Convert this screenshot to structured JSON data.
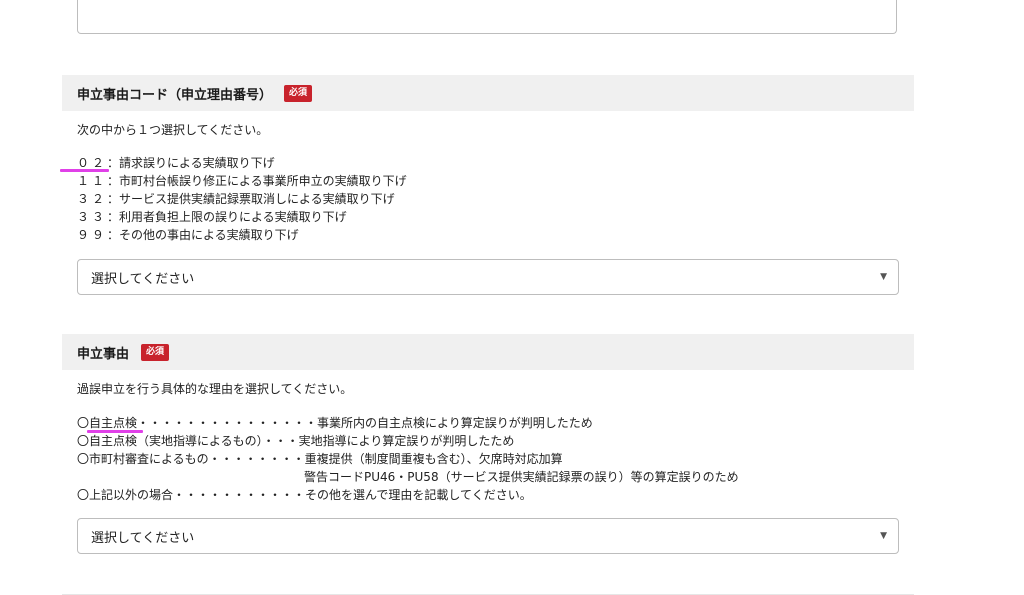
{
  "top_input": {
    "value": ""
  },
  "reason_code_section": {
    "title": "申立事由コード（申立理由番号）",
    "required_badge": "必須",
    "instruction": "次の中から１つ選択してください。",
    "options": [
      {
        "code": "０２",
        "sep": "：",
        "text": "請求誤りによる実績取り下げ"
      },
      {
        "code": "１１",
        "sep": "：",
        "text": "市町村台帳誤り修正による事業所申立の実績取り下げ"
      },
      {
        "code": "３２",
        "sep": "：",
        "text": "サービス提供実績記録票取消しによる実績取り下げ"
      },
      {
        "code": "３３",
        "sep": "：",
        "text": "利用者負担上限の誤りによる実績取り下げ"
      },
      {
        "code": "９９",
        "sep": "：",
        "text": "その他の事由による実績取り下げ"
      }
    ],
    "select": {
      "value": "選択してください"
    }
  },
  "reason_section": {
    "title": "申立事由",
    "required_badge": "必須",
    "instruction": "過誤申立を行う具体的な理由を選択してください。",
    "options": [
      {
        "label": "〇自主点検・・・・・・・・・・・・・・・",
        "text": "事業所内の自主点検により算定誤りが判明したため"
      },
      {
        "label": "〇自主点検（実地指導によるもの）・・・",
        "text": "実地指導により算定誤りが判明したため"
      },
      {
        "label": "〇市町村審査によるもの・・・・・・・・",
        "text": "重複提供（制度間重複も含む）、欠席時対応加算"
      },
      {
        "label": "",
        "text": "警告コードPU46・PU58（サービス提供実績記録票の誤り）等の算定誤りのため"
      },
      {
        "label": "〇上記以外の場合・・・・・・・・・・・",
        "text": "その他を選んで理由を記載してください。"
      }
    ],
    "select": {
      "value": "選択してください"
    }
  },
  "colors": {
    "required_badge": "#c8232c",
    "highlight": "#e040e8",
    "section_header_bg": "#f0f0f0"
  },
  "icons": {
    "select_arrow": "chevron-down-icon"
  }
}
